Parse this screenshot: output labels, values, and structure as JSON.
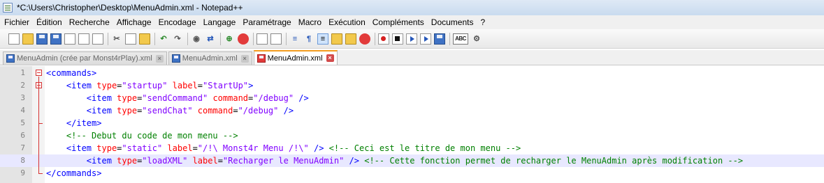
{
  "window": {
    "title": "*C:\\Users\\Christopher\\Desktop\\MenuAdmin.xml - Notepad++"
  },
  "menu": [
    "Fichier",
    "Édition",
    "Recherche",
    "Affichage",
    "Encodage",
    "Langage",
    "Paramétrage",
    "Macro",
    "Exécution",
    "Compléments",
    "Documents",
    "?"
  ],
  "toolbar": {
    "icons": [
      "new-file-icon",
      "open-file-icon",
      "save-icon",
      "save-all-icon",
      "close-icon",
      "close-all-icon",
      "print-icon",
      "cut-icon",
      "copy-icon",
      "paste-icon",
      "undo-icon",
      "redo-icon",
      "find-icon",
      "replace-icon",
      "zoom-in-icon",
      "zoom-out-icon",
      "sync-vertical-icon",
      "sync-horizontal-icon",
      "word-wrap-icon",
      "show-all-chars-icon",
      "indent-guide-icon",
      "user-lang-icon",
      "doc-map-icon",
      "function-list-icon",
      "record-macro-icon",
      "stop-macro-icon",
      "play-macro-icon",
      "run-macro-multiple-icon",
      "save-macro-icon",
      "spell-check-icon",
      "plugin-icon"
    ]
  },
  "tabs": [
    {
      "label": "MenuAdmin (crée par Monst4rPlay).xml",
      "active": false
    },
    {
      "label": "MenuAdmin.xml",
      "active": false
    },
    {
      "label": "MenuAdmin.xml",
      "active": true
    }
  ],
  "editor": {
    "lines": [
      {
        "num": "1",
        "segments": [
          {
            "t": "<commands>",
            "c": "#0000ff"
          }
        ]
      },
      {
        "num": "2",
        "segments": [
          {
            "t": "    ",
            "c": "#000"
          },
          {
            "t": "<item ",
            "c": "#0000ff"
          },
          {
            "t": "type",
            "c": "#ff0000"
          },
          {
            "t": "=",
            "c": "#000"
          },
          {
            "t": "\"startup\"",
            "c": "#8000ff"
          },
          {
            "t": " label",
            "c": "#ff0000"
          },
          {
            "t": "=",
            "c": "#000"
          },
          {
            "t": "\"StartUp\"",
            "c": "#8000ff"
          },
          {
            "t": ">",
            "c": "#0000ff"
          }
        ]
      },
      {
        "num": "3",
        "segments": [
          {
            "t": "        ",
            "c": "#000"
          },
          {
            "t": "<item ",
            "c": "#0000ff"
          },
          {
            "t": "type",
            "c": "#ff0000"
          },
          {
            "t": "=",
            "c": "#000"
          },
          {
            "t": "\"sendCommand\"",
            "c": "#8000ff"
          },
          {
            "t": " command",
            "c": "#ff0000"
          },
          {
            "t": "=",
            "c": "#000"
          },
          {
            "t": "\"/debug\"",
            "c": "#8000ff"
          },
          {
            "t": " />",
            "c": "#0000ff"
          }
        ]
      },
      {
        "num": "4",
        "segments": [
          {
            "t": "        ",
            "c": "#000"
          },
          {
            "t": "<item ",
            "c": "#0000ff"
          },
          {
            "t": "type",
            "c": "#ff0000"
          },
          {
            "t": "=",
            "c": "#000"
          },
          {
            "t": "\"sendChat\"",
            "c": "#8000ff"
          },
          {
            "t": " command",
            "c": "#ff0000"
          },
          {
            "t": "=",
            "c": "#000"
          },
          {
            "t": "\"/debug\"",
            "c": "#8000ff"
          },
          {
            "t": " />",
            "c": "#0000ff"
          }
        ]
      },
      {
        "num": "5",
        "segments": [
          {
            "t": "    ",
            "c": "#000"
          },
          {
            "t": "</item>",
            "c": "#0000ff"
          }
        ]
      },
      {
        "num": "6",
        "segments": [
          {
            "t": "    ",
            "c": "#000"
          },
          {
            "t": "<!-- Debut du code de mon menu -->",
            "c": "#008000"
          }
        ]
      },
      {
        "num": "7",
        "segments": [
          {
            "t": "    ",
            "c": "#000"
          },
          {
            "t": "<item ",
            "c": "#0000ff"
          },
          {
            "t": "type",
            "c": "#ff0000"
          },
          {
            "t": "=",
            "c": "#000"
          },
          {
            "t": "\"static\"",
            "c": "#8000ff"
          },
          {
            "t": " label",
            "c": "#ff0000"
          },
          {
            "t": "=",
            "c": "#000"
          },
          {
            "t": "\"/!\\ Monst4r Menu /!\\\"",
            "c": "#8000ff"
          },
          {
            "t": " />",
            "c": "#0000ff"
          },
          {
            "t": " <!-- Ceci est le titre de mon menu -->",
            "c": "#008000"
          }
        ]
      },
      {
        "num": "8",
        "segments": [
          {
            "t": "        ",
            "c": "#000"
          },
          {
            "t": "<item ",
            "c": "#0000ff"
          },
          {
            "t": "type",
            "c": "#ff0000"
          },
          {
            "t": "=",
            "c": "#000"
          },
          {
            "t": "\"loadXML\"",
            "c": "#8000ff"
          },
          {
            "t": " label",
            "c": "#ff0000"
          },
          {
            "t": "=",
            "c": "#000"
          },
          {
            "t": "\"Recharger le MenuAdmin\"",
            "c": "#8000ff"
          },
          {
            "t": " />",
            "c": "#0000ff"
          },
          {
            "t": " <!-- Cette fonction permet de recharger le MenuAdmin après modification -->",
            "c": "#008000"
          }
        ]
      },
      {
        "num": "9",
        "segments": [
          {
            "t": "</commands>",
            "c": "#0000ff"
          }
        ]
      }
    ],
    "current_line": 8
  },
  "colors": {
    "tag": "#0000ff",
    "attribute": "#ff0000",
    "value": "#8000ff",
    "comment": "#008000",
    "fold": "#d63030",
    "current_line_bg": "#e8e8ff",
    "active_tab_accent": "#f39c1f"
  }
}
